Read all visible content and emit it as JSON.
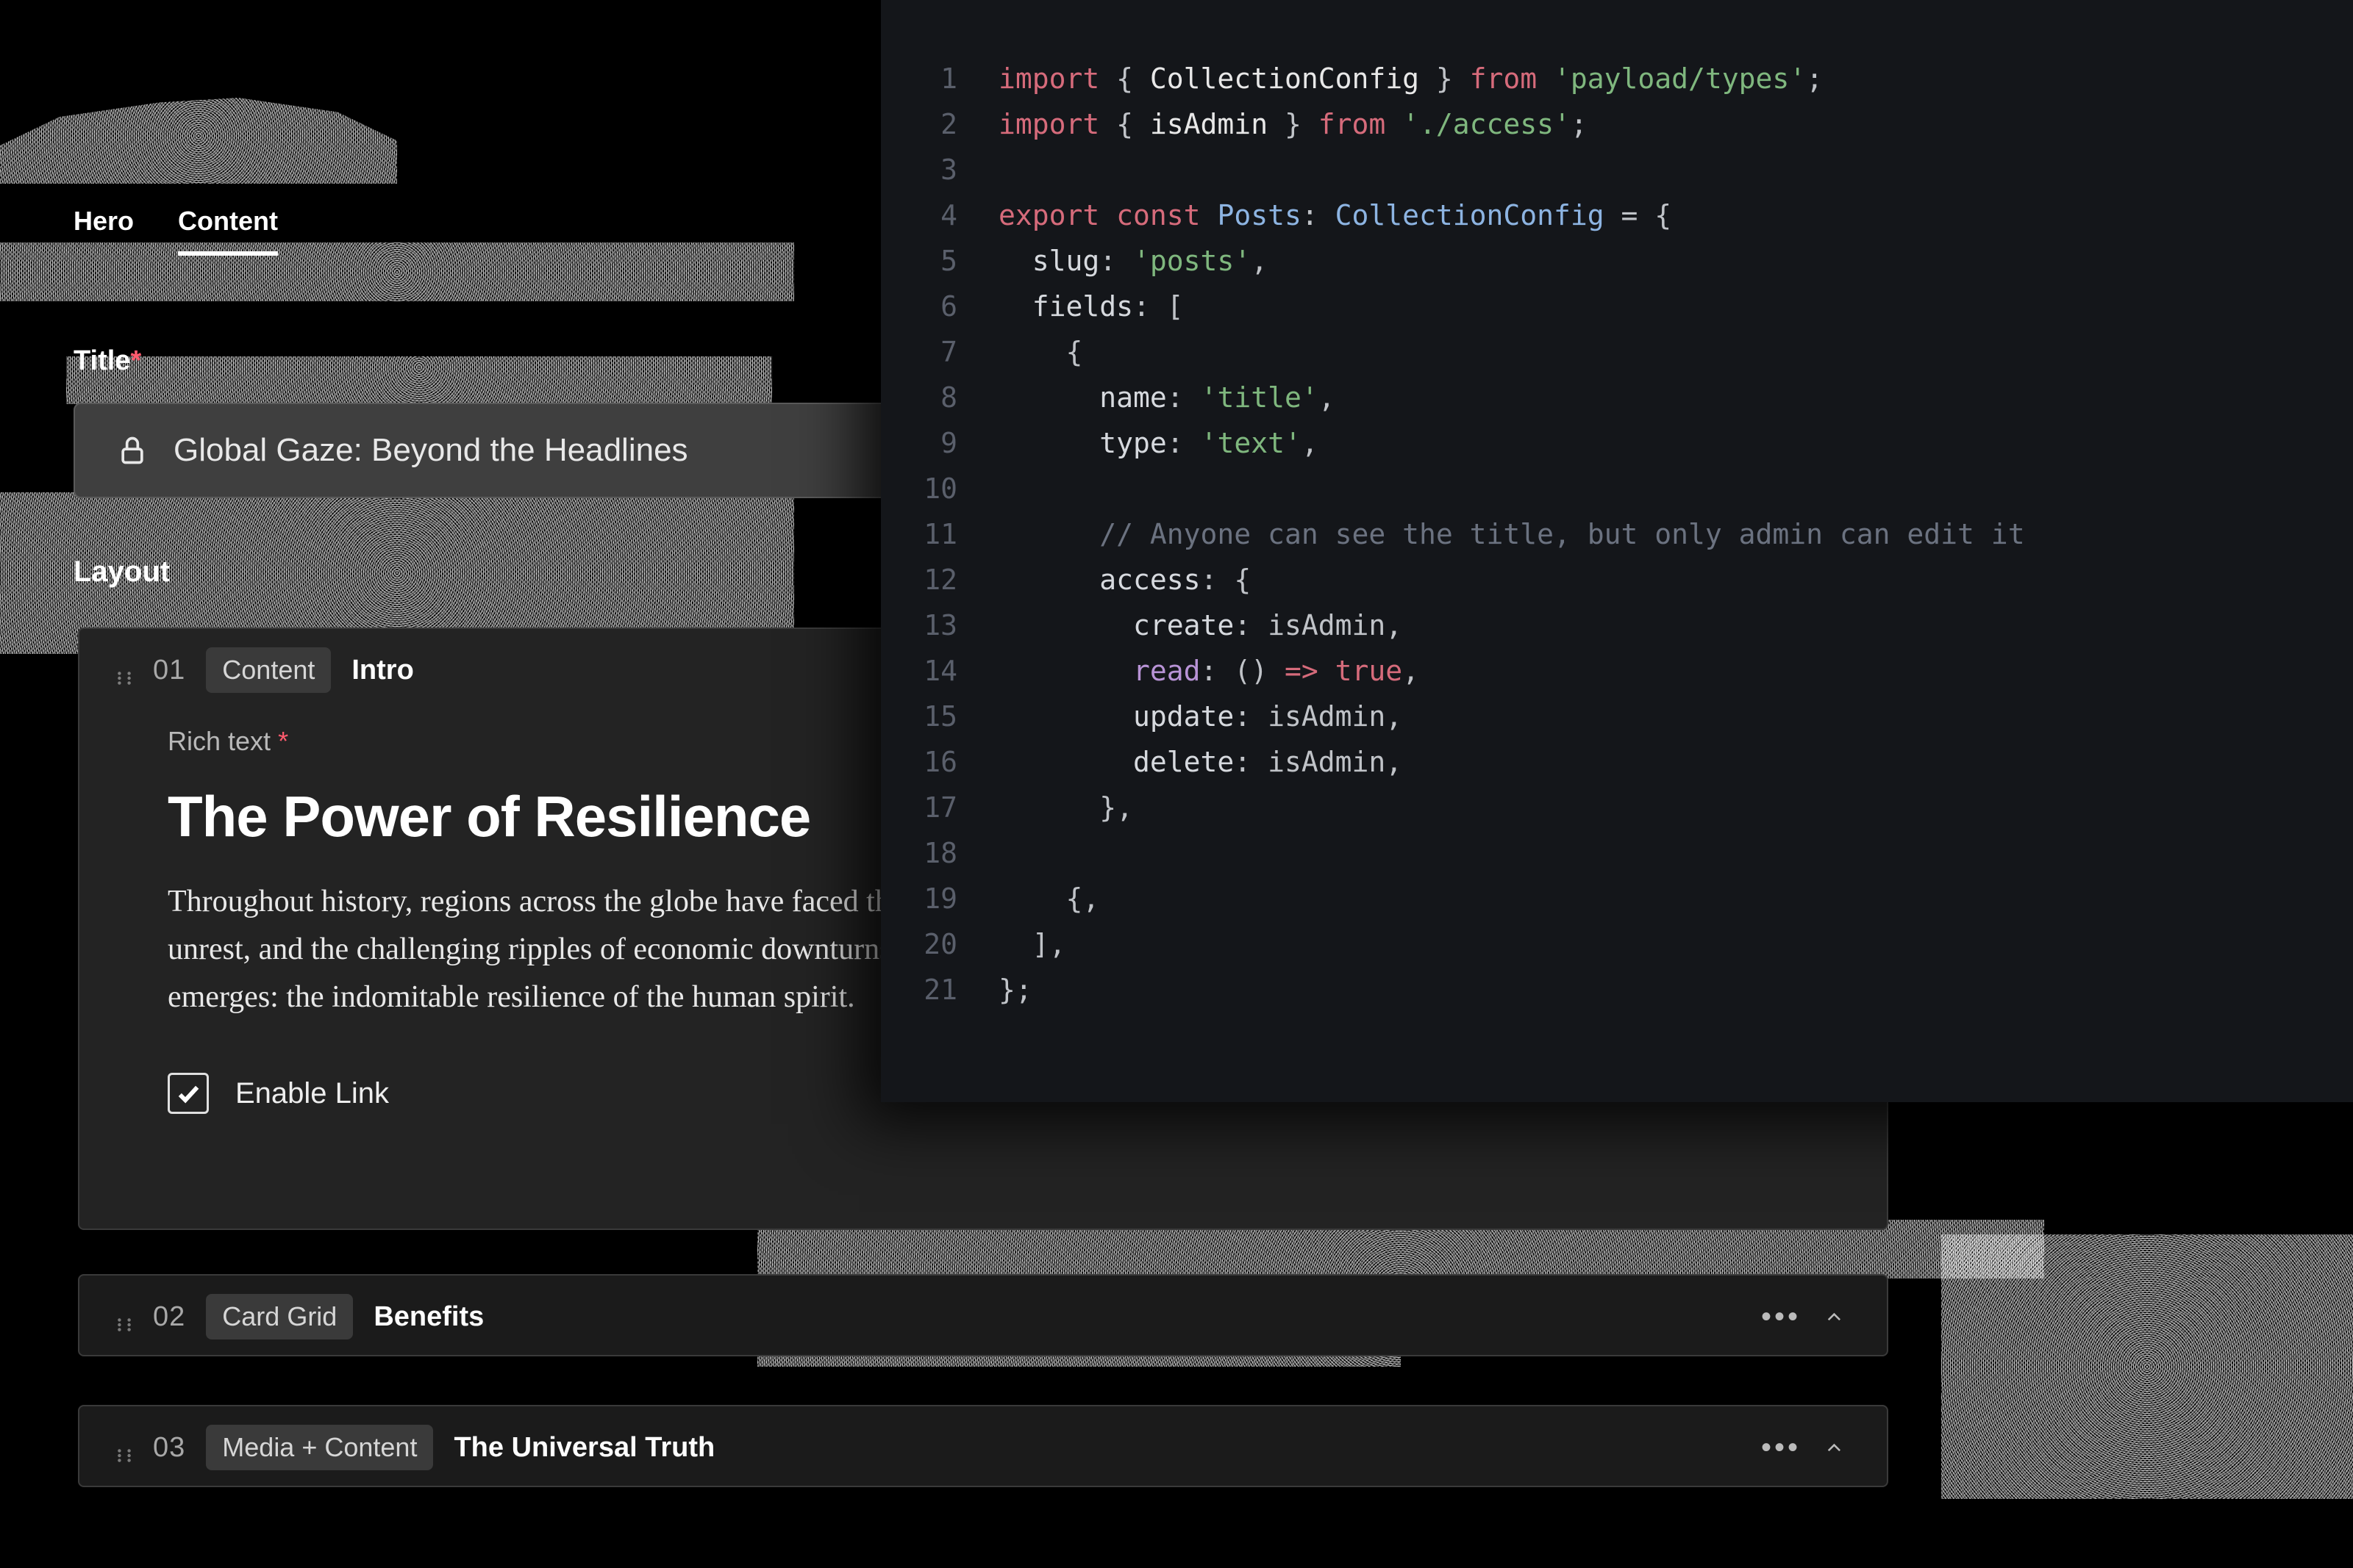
{
  "header": {
    "tabs": [
      {
        "label": "Hero",
        "active": false
      },
      {
        "label": "Content",
        "active": true
      }
    ]
  },
  "title_field": {
    "label": "Title",
    "required": true,
    "locked": true,
    "value": "Global Gaze: Beyond the Headlines"
  },
  "layout_label": "Layout",
  "blocks": [
    {
      "num": "01",
      "chip": "Content",
      "name": "Intro",
      "expanded": true,
      "rich_text": {
        "label": "Rich text",
        "required": true,
        "heading": "The Power of Resilience",
        "body": "Throughout history, regions across the globe have faced the devastating impact of natural disasters, the turbulence of political unrest, and the challenging ripples of economic downturns. In these moments of profound crisis, a remarkable phenomenon often emerges: the indomitable resilience of the human spirit."
      },
      "checkbox": {
        "label": "Enable Link",
        "checked": true
      }
    },
    {
      "num": "02",
      "chip": "Card Grid",
      "name": "Benefits",
      "expanded": false
    },
    {
      "num": "03",
      "chip": "Media + Content",
      "name": "The Universal Truth",
      "expanded": false
    }
  ],
  "code": {
    "lines": [
      [
        [
          "kw",
          "import"
        ],
        [
          "punc",
          " { "
        ],
        [
          "type",
          "CollectionConfig"
        ],
        [
          "punc",
          " } "
        ],
        [
          "kw",
          "from"
        ],
        [
          "punc",
          " "
        ],
        [
          "str",
          "'payload/types'"
        ],
        [
          "punc",
          ";"
        ]
      ],
      [
        [
          "kw",
          "import"
        ],
        [
          "punc",
          " { "
        ],
        [
          "type",
          "isAdmin"
        ],
        [
          "punc",
          " } "
        ],
        [
          "kw",
          "from"
        ],
        [
          "punc",
          " "
        ],
        [
          "str",
          "'./access'"
        ],
        [
          "punc",
          ";"
        ]
      ],
      [],
      [
        [
          "kw",
          "export"
        ],
        [
          "punc",
          " "
        ],
        [
          "kw",
          "const"
        ],
        [
          "punc",
          " "
        ],
        [
          "name",
          "Posts"
        ],
        [
          "punc",
          ": "
        ],
        [
          "name",
          "CollectionConfig"
        ],
        [
          "punc",
          " = {"
        ]
      ],
      [
        [
          "punc",
          "  "
        ],
        [
          "prop",
          "slug"
        ],
        [
          "punc",
          ": "
        ],
        [
          "str",
          "'posts'"
        ],
        [
          "punc",
          ","
        ]
      ],
      [
        [
          "punc",
          "  "
        ],
        [
          "prop",
          "fields"
        ],
        [
          "punc",
          ": ["
        ]
      ],
      [
        [
          "punc",
          "    {"
        ]
      ],
      [
        [
          "punc",
          "      "
        ],
        [
          "prop",
          "name"
        ],
        [
          "punc",
          ": "
        ],
        [
          "str",
          "'title'"
        ],
        [
          "punc",
          ","
        ]
      ],
      [
        [
          "punc",
          "      "
        ],
        [
          "prop",
          "type"
        ],
        [
          "punc",
          ": "
        ],
        [
          "str",
          "'text'"
        ],
        [
          "punc",
          ","
        ]
      ],
      [],
      [
        [
          "punc",
          "      "
        ],
        [
          "cmnt",
          "// Anyone can see the title, but only admin can edit it"
        ]
      ],
      [
        [
          "punc",
          "      "
        ],
        [
          "prop",
          "access"
        ],
        [
          "punc",
          ": {"
        ]
      ],
      [
        [
          "punc",
          "        "
        ],
        [
          "prop",
          "create"
        ],
        [
          "punc",
          ": isAdmin,"
        ]
      ],
      [
        [
          "punc",
          "        "
        ],
        [
          "key",
          "read"
        ],
        [
          "punc",
          ": () "
        ],
        [
          "arrow",
          "=>"
        ],
        [
          "punc",
          " "
        ],
        [
          "bool",
          "true"
        ],
        [
          "punc",
          ","
        ]
      ],
      [
        [
          "punc",
          "        "
        ],
        [
          "prop",
          "update"
        ],
        [
          "punc",
          ": isAdmin,"
        ]
      ],
      [
        [
          "punc",
          "        "
        ],
        [
          "prop",
          "delete"
        ],
        [
          "punc",
          ": isAdmin,"
        ]
      ],
      [
        [
          "punc",
          "      },"
        ]
      ],
      [],
      [
        [
          "punc",
          "    {,"
        ]
      ],
      [
        [
          "punc",
          "  ],"
        ]
      ],
      [
        [
          "punc",
          "};"
        ]
      ]
    ]
  },
  "icons": {
    "lock": "lock-icon",
    "drag": "drag-handle-icon",
    "more": "more-horizontal-icon",
    "chevron": "chevron-up-icon",
    "check": "check-icon"
  }
}
